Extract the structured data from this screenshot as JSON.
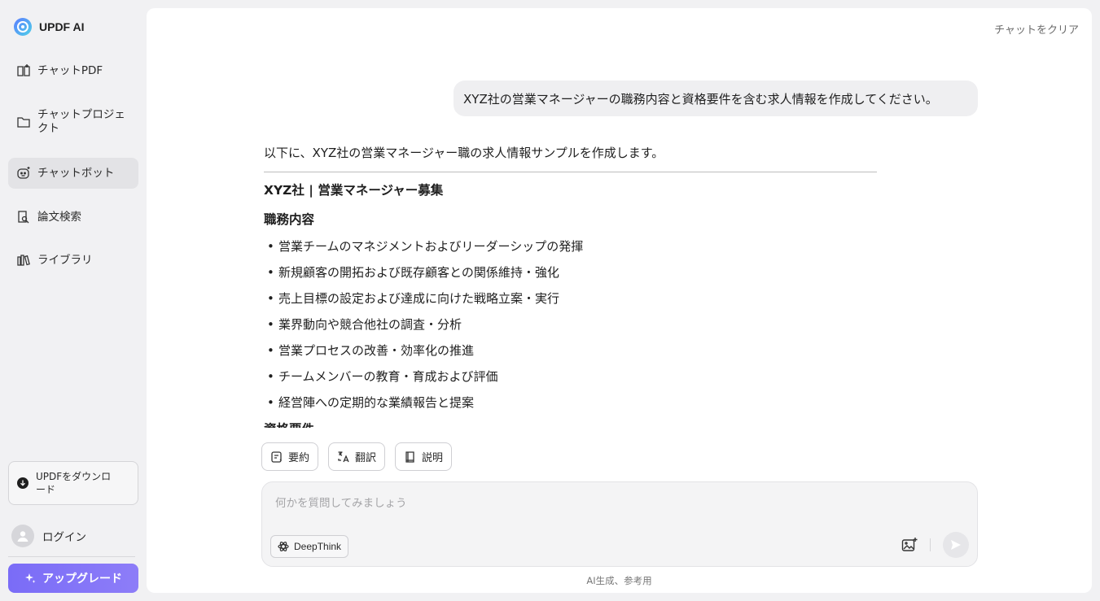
{
  "app": {
    "brand": "UPDF AI"
  },
  "sidebar": {
    "items": [
      {
        "label": "チャットPDF",
        "icon": "book-open-icon"
      },
      {
        "label": "チャットプロジェクト",
        "icon": "folder-icon"
      },
      {
        "label": "チャットボット",
        "icon": "bot-face-icon",
        "active": true
      },
      {
        "label": "論文検索",
        "icon": "doc-search-icon"
      },
      {
        "label": "ライブラリ",
        "icon": "library-icon"
      }
    ],
    "download_label": "UPDFをダウンロード",
    "login_label": "ログイン",
    "upgrade_label": "アップグレード"
  },
  "header": {
    "clear_label": "チャットをクリア"
  },
  "chat": {
    "user_message": "XYZ社の営業マネージャーの職務内容と資格要件を含む求人情報を作成してください。",
    "answer": {
      "intro": "以下に、XYZ社の営業マネージャー職の求人情報サンプルを作成します。",
      "title": "XYZ社 | 営業マネージャー募集",
      "section1": "職務内容",
      "duties": [
        "営業チームのマネジメントおよびリーダーシップの発揮",
        "新規顧客の開拓および既存顧客との関係維持・強化",
        "売上目標の設定および達成に向けた戦略立案・実行",
        "業界動向や競合他社の調査・分析",
        "営業プロセスの改善・効率化の推進",
        "チームメンバーの教育・育成および評価",
        "経営陣への定期的な業績報告と提案"
      ],
      "section2": "資格要件"
    }
  },
  "quick_actions": [
    {
      "label": "要約",
      "icon": "summary-icon"
    },
    {
      "label": "翻訳",
      "icon": "translate-icon"
    },
    {
      "label": "説明",
      "icon": "explain-book-icon"
    }
  ],
  "composer": {
    "placeholder": "何かを質問してみましょう",
    "deepthink_label": "DeepThink"
  },
  "footer": {
    "disclaimer": "AI生成、参考用"
  },
  "colors": {
    "accent": "#7a6cf7",
    "active_bg": "#e3e3e6",
    "bubble_bg": "#efeff1"
  }
}
